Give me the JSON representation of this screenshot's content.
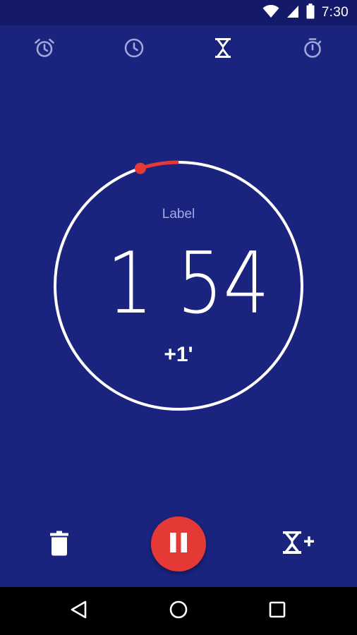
{
  "status_bar": {
    "time": "7:30",
    "icons": [
      "wifi-icon",
      "signal-icon",
      "battery-icon"
    ]
  },
  "tabs": [
    {
      "name": "alarm",
      "icon": "alarm-clock-icon",
      "active": false
    },
    {
      "name": "clock",
      "icon": "clock-icon",
      "active": false
    },
    {
      "name": "timer",
      "icon": "hourglass-icon",
      "active": true
    },
    {
      "name": "stopwatch",
      "icon": "stopwatch-icon",
      "active": false
    }
  ],
  "timer": {
    "label": "Label",
    "minutes": "1",
    "seconds": "54",
    "add_minute": "+1'",
    "remaining_fraction": 0.95
  },
  "actions": {
    "delete": "trash-icon",
    "pause": "pause-icon",
    "add_timer": "add-timer-icon"
  },
  "navigation": [
    "back-icon",
    "home-icon",
    "recents-icon"
  ],
  "colors": {
    "background": "#1a237e",
    "status_bar": "#14196a",
    "accent": "#e53935",
    "tab_inactive": "#9fa8da",
    "label": "#a4abe0"
  }
}
